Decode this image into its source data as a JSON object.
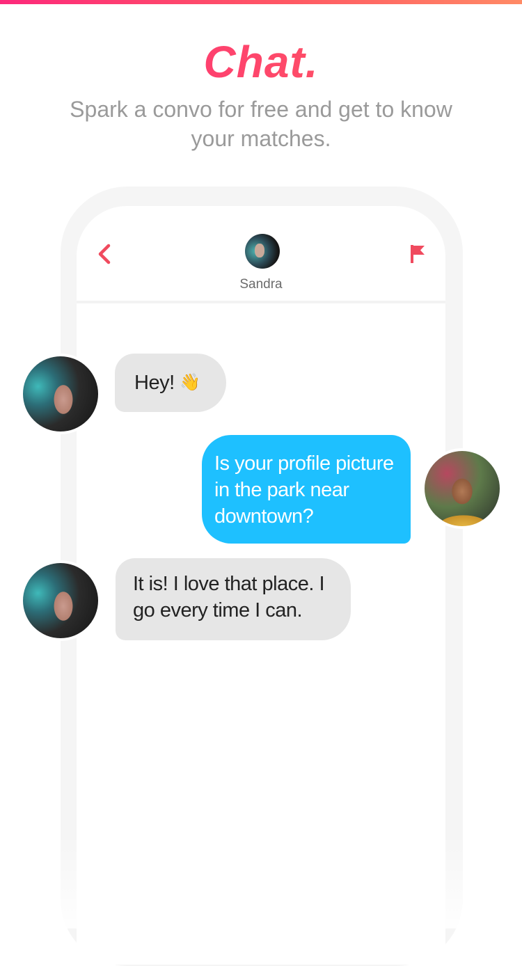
{
  "colors": {
    "accent": "#fd297b",
    "accent_end": "#ff655b",
    "outgoing_bubble": "#1ec0ff",
    "incoming_bubble": "#e6e6e6",
    "subtitle": "#9a9a9a"
  },
  "promo": {
    "headline": "Chat.",
    "subtitle": "Spark a convo for free and get to know your matches."
  },
  "chat_header": {
    "back_icon": "chevron-left-icon",
    "flag_icon": "flag-icon",
    "match_name": "Sandra"
  },
  "messages": [
    {
      "sender": "match",
      "text": "Hey!",
      "emoji": "👋"
    },
    {
      "sender": "me",
      "text": "Is your profile picture in the park near downtown?"
    },
    {
      "sender": "match",
      "text": "It is! I love that place. I go every time I can."
    }
  ]
}
